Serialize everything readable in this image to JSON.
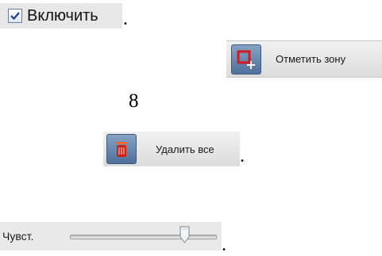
{
  "enable_checkbox": {
    "label": "Включить",
    "checked": true,
    "trailing": "."
  },
  "mark_zone_button": {
    "label": "Отметить зону",
    "icon": "mark-zone-icon"
  },
  "page_number": "8",
  "delete_all_button": {
    "label": "Удалить все",
    "icon": "trash-icon",
    "trailing": "."
  },
  "sensitivity": {
    "label": "Чувст.",
    "value_fraction": 0.78,
    "trailing": "."
  }
}
